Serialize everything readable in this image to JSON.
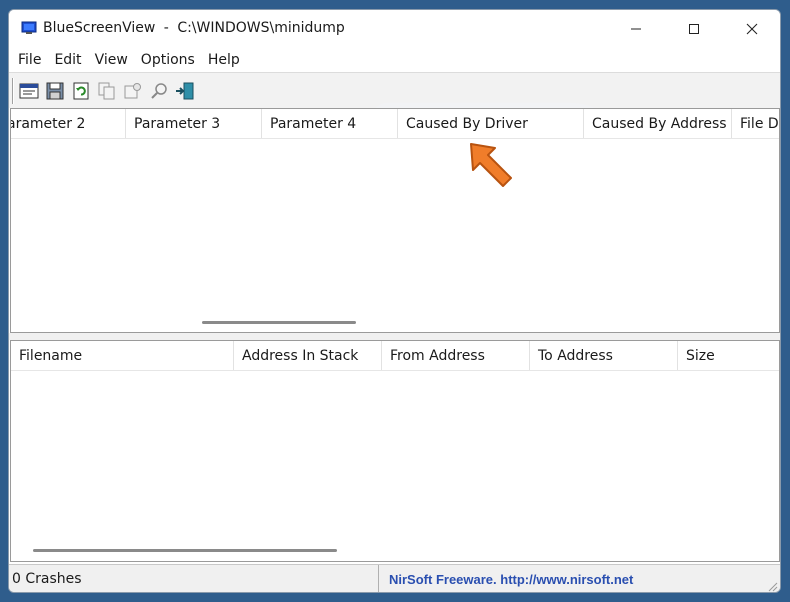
{
  "window": {
    "app_name": "BlueScreenView",
    "separator": "-",
    "path": "C:\\WINDOWS\\minidump"
  },
  "menu": [
    "File",
    "Edit",
    "View",
    "Options",
    "Help"
  ],
  "toolbar_icons": [
    "properties-icon",
    "save-icon",
    "refresh-icon",
    "copy-icon",
    "options-icon",
    "find-icon",
    "exit-icon"
  ],
  "top_table": {
    "columns": [
      "arameter 2",
      "Parameter 3",
      "Parameter 4",
      "Caused By Driver",
      "Caused By Address",
      "File De"
    ]
  },
  "bottom_table": {
    "columns": [
      "Filename",
      "Address In Stack",
      "From Address",
      "To Address",
      "Size"
    ]
  },
  "status": {
    "crashes": "0 Crashes",
    "credit": "NirSoft Freeware.  http://www.nirsoft.net"
  },
  "colors": {
    "desktop": "#2f5d8c",
    "link": "#2a4fb0",
    "arrow": "#f07d2a"
  }
}
